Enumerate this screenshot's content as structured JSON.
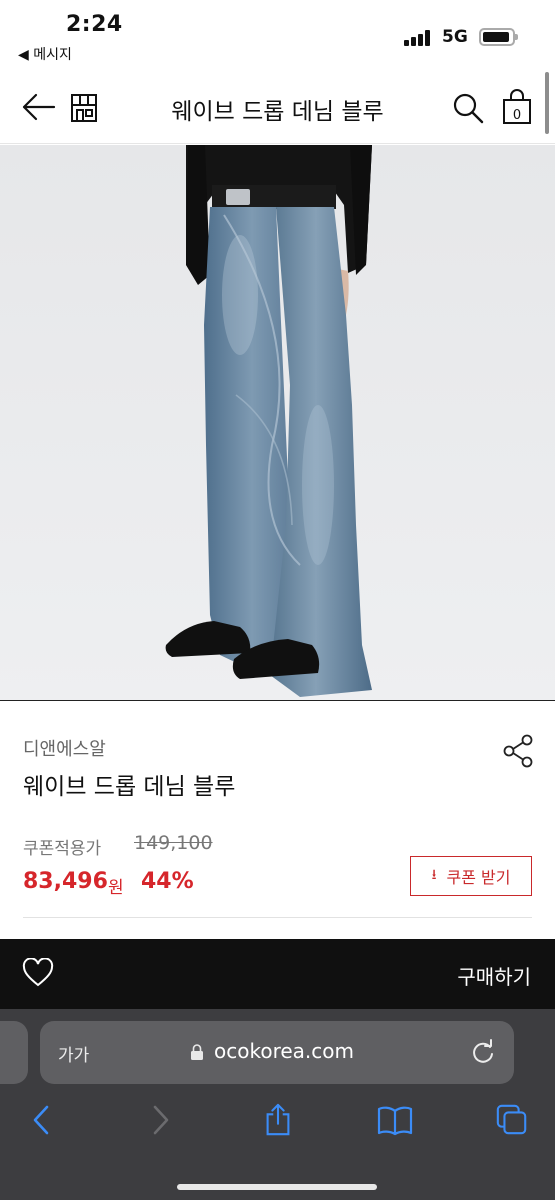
{
  "status_bar": {
    "time": "2:24",
    "back_app": "◀ 메시지",
    "network": "5G"
  },
  "header": {
    "title": "웨이브 드롭 데님 블루",
    "icons": [
      "back-arrow-icon",
      "store-icon",
      "search-icon",
      "shopping-bag-icon"
    ],
    "cart_count": "0"
  },
  "product": {
    "brand": "디앤에스알",
    "name": "웨이브 드롭 데님 블루",
    "coupon_price_label": "쿠폰적용가",
    "original_price": "149,100",
    "sale_price": "83,496",
    "currency": "원",
    "discount": "44%",
    "coupon_button_label": "쿠폰 받기",
    "accent_color": "#d6262b"
  },
  "buy_bar": {
    "buy_label": "구매하기"
  },
  "browser": {
    "text_size_label": "가가",
    "url": "ocokorea.com"
  }
}
